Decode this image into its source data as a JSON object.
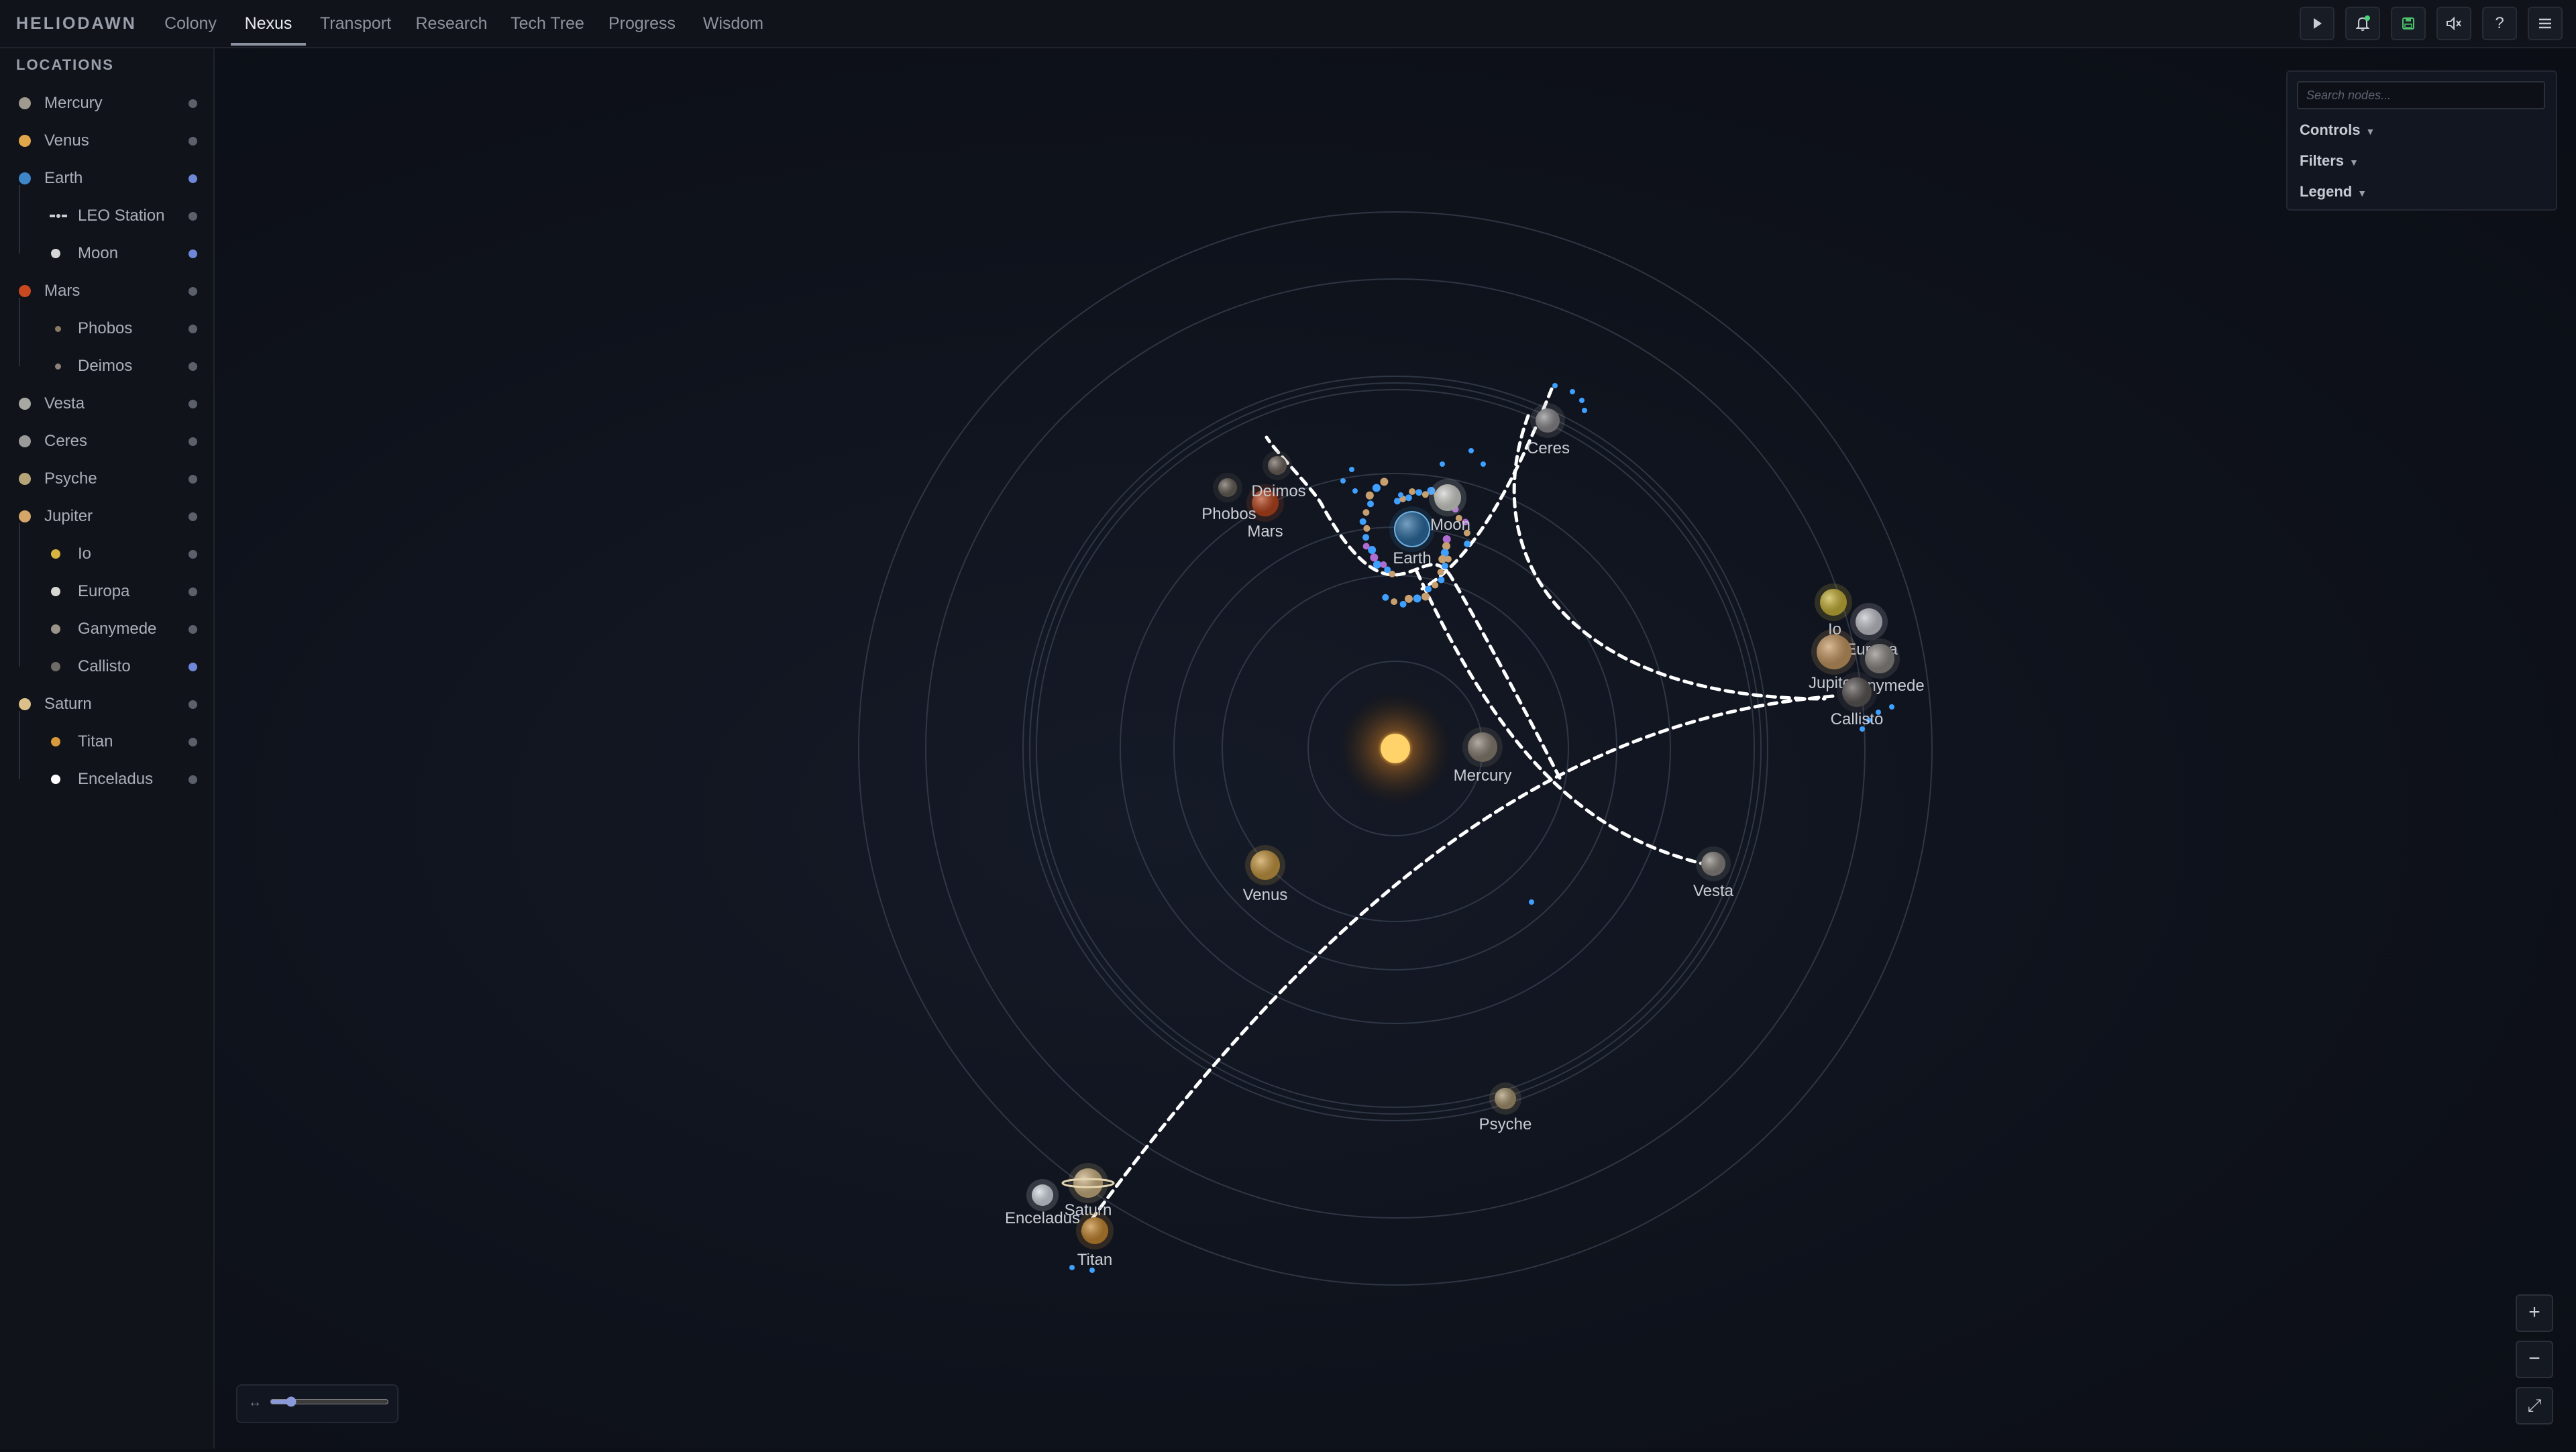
{
  "app": {
    "title": "HELIODAWN"
  },
  "nav": {
    "tabs": [
      {
        "label": "Colony"
      },
      {
        "label": "Nexus"
      },
      {
        "label": "Transport"
      },
      {
        "label": "Research"
      },
      {
        "label": "Tech Tree"
      },
      {
        "label": "Progress"
      },
      {
        "label": "Wisdom"
      }
    ],
    "active": "Nexus"
  },
  "toolbar": {
    "icons": [
      "play-icon",
      "bell-icon",
      "save-icon",
      "mute-icon",
      "help-icon",
      "menu-icon"
    ],
    "help_label": "?"
  },
  "sidebar": {
    "heading": "LOCATIONS",
    "items": [
      {
        "label": "Mercury",
        "color": "#a09a8e",
        "active": false
      },
      {
        "label": "Venus",
        "color": "#e0a64a",
        "active": false
      },
      {
        "label": "Earth",
        "color": "#3f86c8",
        "active": true
      },
      {
        "label": "LEO Station",
        "color": "#c8ccd4",
        "active": false,
        "icon": "satellite-icon"
      },
      {
        "label": "Moon",
        "color": "#d6d6d6",
        "active": true
      },
      {
        "label": "Mars",
        "color": "#c8481f",
        "active": false
      },
      {
        "label": "Phobos",
        "color": "#8a7a64",
        "active": false
      },
      {
        "label": "Deimos",
        "color": "#8d8178",
        "active": false
      },
      {
        "label": "Vesta",
        "color": "#a8a8a2",
        "active": false
      },
      {
        "label": "Ceres",
        "color": "#9a9a9a",
        "active": false
      },
      {
        "label": "Psyche",
        "color": "#b4a478",
        "active": false
      },
      {
        "label": "Jupiter",
        "color": "#d4a668",
        "active": false
      },
      {
        "label": "Io",
        "color": "#d8b440",
        "active": false
      },
      {
        "label": "Europa",
        "color": "#d8d8d2",
        "active": false
      },
      {
        "label": "Ganymede",
        "color": "#9a948a",
        "active": false
      },
      {
        "label": "Callisto",
        "color": "#6e6a66",
        "active": true
      },
      {
        "label": "Saturn",
        "color": "#dcc08a",
        "active": false
      },
      {
        "label": "Titan",
        "color": "#d89a3a",
        "active": false
      },
      {
        "label": "Enceladus",
        "color": "#ffffff",
        "active": false
      }
    ]
  },
  "map": {
    "bodies": [
      {
        "name": "Mercury",
        "color": "#8a8176"
      },
      {
        "name": "Venus",
        "color": "#c89a44"
      },
      {
        "name": "Earth",
        "color": "#2f6fa3"
      },
      {
        "name": "Moon",
        "color": "#d4d4d0"
      },
      {
        "name": "Mars",
        "color": "#b8461f"
      },
      {
        "name": "Phobos",
        "color": "#6a625a"
      },
      {
        "name": "Deimos",
        "color": "#6f665e"
      },
      {
        "name": "Ceres",
        "color": "#8e8e92"
      },
      {
        "name": "Vesta",
        "color": "#8c8782"
      },
      {
        "name": "Psyche",
        "color": "#a89670"
      },
      {
        "name": "Io",
        "color": "#c8b43c"
      },
      {
        "name": "Europa",
        "color": "#c6c8d0"
      },
      {
        "name": "Jupiter",
        "color": "#c89a64"
      },
      {
        "name": "Ganymede",
        "color": "#8e8a86"
      },
      {
        "name": "Callisto",
        "color": "#5e5a58"
      },
      {
        "name": "Saturn",
        "color": "#cdb383"
      },
      {
        "name": "Enceladus",
        "color": "#d6dce6"
      },
      {
        "name": "Titan",
        "color": "#c88a34"
      }
    ],
    "sun_color": "#ffd36a",
    "route_color": "#ffffff",
    "swarm_colors": [
      "#3fa0ff",
      "#c8a070",
      "#b06cd0"
    ]
  },
  "panel": {
    "search_placeholder": "Search nodes...",
    "sections": [
      {
        "label": "Controls"
      },
      {
        "label": "Filters"
      },
      {
        "label": "Legend"
      }
    ]
  },
  "zoom": {
    "in_label": "+",
    "out_label": "−",
    "fit_label": "⤢"
  },
  "timeline": {
    "icon_label": "↔",
    "value": 0.15
  }
}
